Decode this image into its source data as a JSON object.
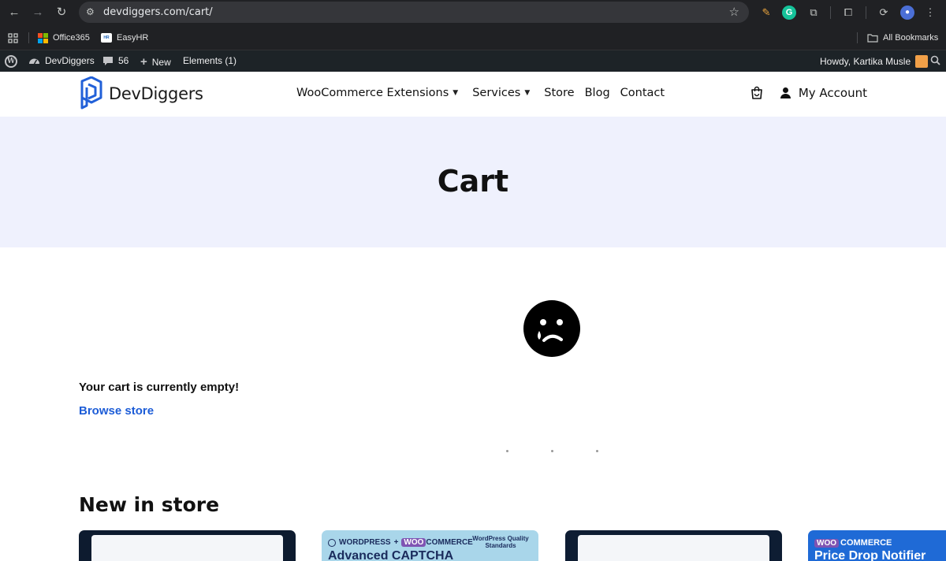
{
  "browser": {
    "url": "devdiggers.com/cart/",
    "bookmarks": [
      {
        "label": "Office365",
        "icon": "office365-icon"
      },
      {
        "label": "EasyHR",
        "icon": "easyhr-icon"
      }
    ],
    "all_bookmarks": "All Bookmarks"
  },
  "admin_bar": {
    "site_name": "DevDiggers",
    "comments_count": "56",
    "new_label": "New",
    "elements_label": "Elements (1)",
    "howdy": "Howdy, Kartika Musle"
  },
  "header": {
    "logo_text": "DevDiggers",
    "nav": [
      {
        "label": "WooCommerce Extensions",
        "dropdown": true
      },
      {
        "label": "Services",
        "dropdown": true
      },
      {
        "label": "Store",
        "dropdown": false
      },
      {
        "label": "Blog",
        "dropdown": false
      },
      {
        "label": "Contact",
        "dropdown": false
      }
    ],
    "account_label": "My Account"
  },
  "hero": {
    "title": "Cart"
  },
  "cart": {
    "empty_message": "Your cart is currently empty!",
    "browse_label": "Browse store"
  },
  "new_in_store": {
    "heading": "New in store",
    "cards": [
      {
        "type": "screenshot"
      },
      {
        "brand_wp": "WORDPRESS",
        "brand_woo": "WOO",
        "brand_commerce": "COMMERCE",
        "badge": "WordPress Quality Standards",
        "title": "Advanced CAPTCHA"
      },
      {
        "type": "screenshot"
      },
      {
        "brand_woo": "WOO",
        "brand_commerce": "COMMERCE",
        "title": "Price Drop Notifier"
      }
    ]
  },
  "colors": {
    "accent_link": "#1c5cd7",
    "hero_bg": "#eff1fd",
    "logo_blue": "#2160d8"
  }
}
